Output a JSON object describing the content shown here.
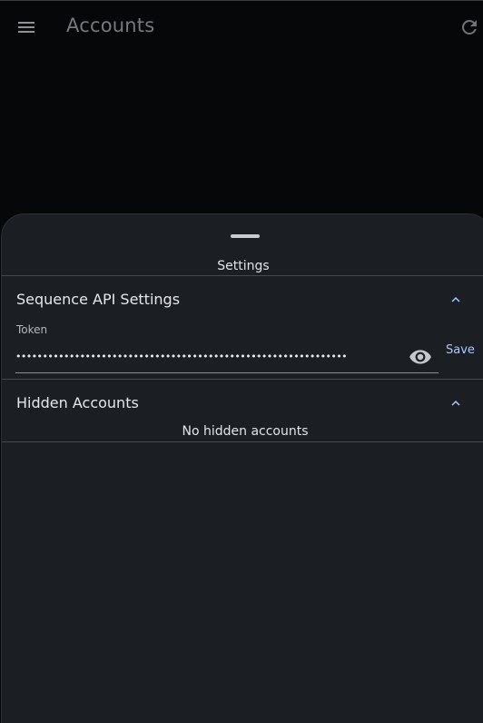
{
  "app_bar": {
    "title": "Accounts",
    "menu_icon": "menu-icon",
    "refresh_icon": "refresh-icon"
  },
  "sheet": {
    "title": "Settings",
    "sections": [
      {
        "title": "Sequence API Settings",
        "expanded": true,
        "token_label": "Token",
        "token_value": "••••••••••••••••••••••••••••••••••••••••••••••••••••••••••••••",
        "visibility_icon": "eye-icon",
        "save_label": "Save"
      },
      {
        "title": "Hidden Accounts",
        "expanded": true,
        "empty_text": "No hidden accounts"
      }
    ]
  },
  "colors": {
    "background": "#060709",
    "sheet": "#1b1e23",
    "accent": "#a9c7ff",
    "divider": "#45484d"
  }
}
